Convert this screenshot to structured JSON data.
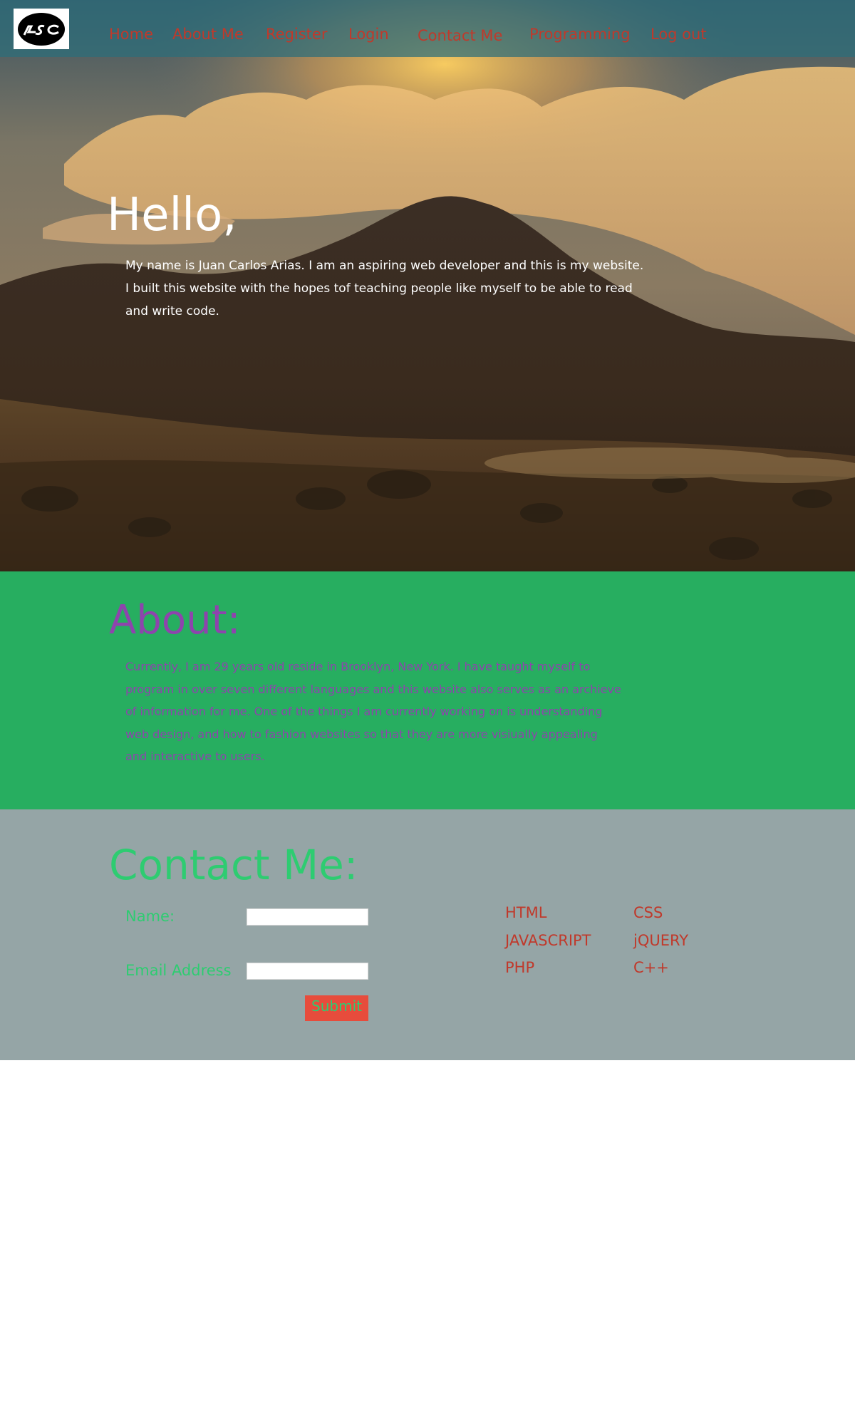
{
  "nav": {
    "logo_text": "LSC",
    "links": [
      "Home",
      "About Me",
      "Register",
      "Login",
      "Contact Me",
      "Programming",
      "Log out"
    ]
  },
  "hero": {
    "heading": "Hello,",
    "lines": [
      "My name is Juan Carlos Arias.  I am an aspiring web developer and this is my website.",
      "I built this website with the hopes tof teaching people like myself to be able to read",
      "and write code."
    ]
  },
  "about": {
    "title": "About:",
    "lines": [
      "Currently, I am 29 years old reside in Brooklyn, New York.  I have taught myself to",
      " program in over seven different languages and this website also serves as an archieve",
      " of information for me. One of the things I am currently working on is understanding",
      "web design, and how to fashion websites so that they are more visiually appealing",
      " and interactive to users."
    ]
  },
  "contact": {
    "title": "Contact Me:",
    "name_label": "Name:",
    "email_label": "Email Address",
    "name_value": "",
    "email_value": "",
    "submit_label": "Submit",
    "skills": [
      "HTML",
      "CSS",
      "JAVASCRIPT",
      "jQUERY",
      "PHP",
      "C++"
    ]
  },
  "colors": {
    "nav_link": "#c0392b",
    "about_bg": "#27ae60",
    "about_text": "#8e44ad",
    "contact_bg": "#95a5a6",
    "contact_text": "#2ecc71",
    "submit_bg": "#e74c3c"
  },
  "icons": {
    "logo": "lsc-logo-icon"
  }
}
